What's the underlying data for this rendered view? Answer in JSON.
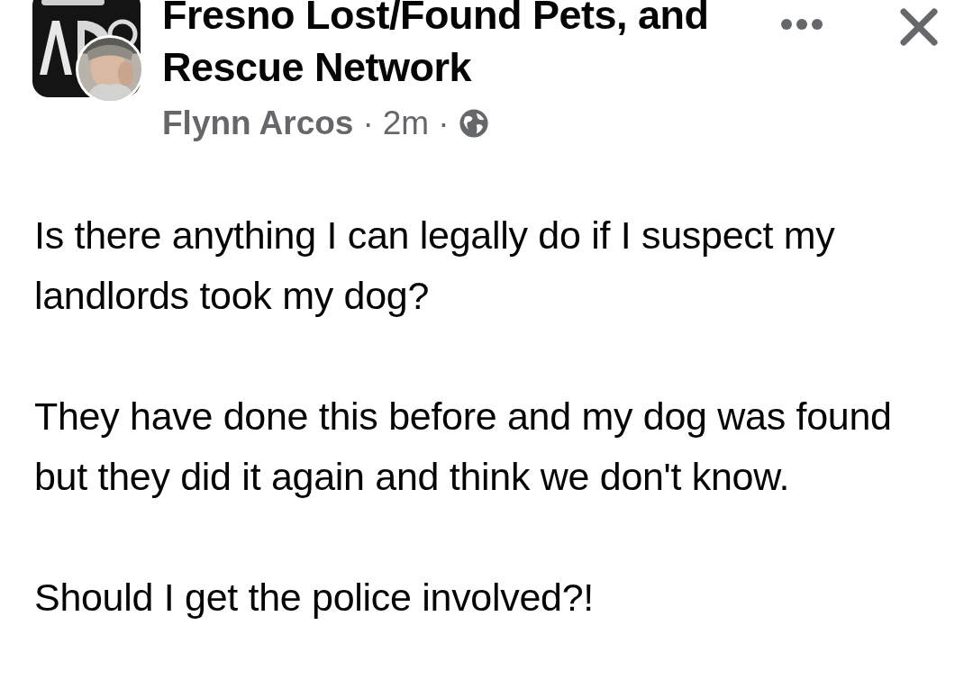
{
  "post": {
    "group_name": "Fresno Lost/Found Pets, and Rescue Network",
    "author": "Flynn Arcos",
    "separator_1": "·",
    "time": "2m",
    "separator_2": "·",
    "paragraphs": [
      "Is there anything I can legally do if I suspect my landlords took my dog?",
      "They have done this before and my dog was found but they did it again and think we don't know.",
      "Should I get the police involved?!"
    ]
  }
}
